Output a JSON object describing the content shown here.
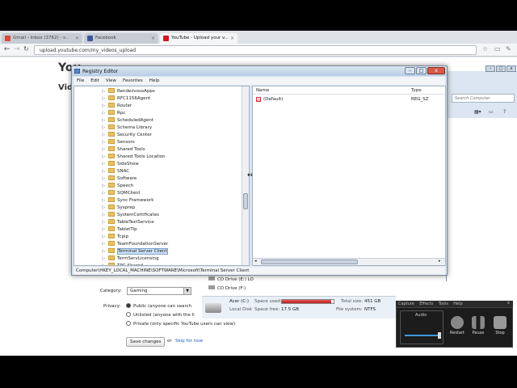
{
  "browser": {
    "tabs": [
      {
        "label": "Gmail - Inbox (3762) - s...",
        "favicon_color": "#d64937"
      },
      {
        "label": "Facebook",
        "favicon_color": "#3b5998"
      },
      {
        "label": "YouTube - Upload your v...",
        "favicon_color": "#cc181e"
      }
    ],
    "address": "upload.youtube.com/my_videos_upload"
  },
  "youtube": {
    "logo": "You",
    "heading": "Vid",
    "category_label": "Category:",
    "category_value": "Gaming",
    "privacy_label": "Privacy:",
    "privacy_options": [
      "Public (anyone can search",
      "Unlisted (anyone with the li",
      "Private (only specific YouTube users can view)"
    ],
    "save_button": "Save changes",
    "or_text": "or",
    "skip_link": "Skip for now"
  },
  "registry": {
    "title": "Registry Editor",
    "menu": [
      "File",
      "Edit",
      "View",
      "Favorites",
      "Help"
    ],
    "tree_items": [
      "RendezvousApps",
      "RFC1156Agent",
      "Router",
      "Rpc",
      "ScheduledAgent",
      "Schema Library",
      "Security Center",
      "Sensors",
      "Shared Tools",
      "Shared Tools Location",
      "SideShow",
      "SNAC",
      "Software",
      "Speech",
      "SQMClient",
      "Sync Framework",
      "Sysprep",
      "SystemCertificates",
      "TableTextService",
      "TabletTip",
      "Tcpip",
      "TeamFoundationServer",
      "Terminal Server Client",
      "TermServLicensing",
      "TPG Shared"
    ],
    "selected_item": "Terminal Server Client",
    "columns": {
      "name": "Name",
      "type": "Type"
    },
    "values": [
      {
        "name": "(Default)",
        "type": "REG_SZ"
      }
    ],
    "status_path": "Computer\\HKEY_LOCAL_MACHINE\\SOFTWARE\\Microsoft\\Terminal Server Client"
  },
  "explorer": {
    "search_placeholder": "Search Computer",
    "drives": [
      "CD Drive (E:) LO",
      "CD Drive (F:)"
    ],
    "details": {
      "drive_name": "Acer (C:)",
      "space_used_label": "Space used:",
      "total_size_label": "Total size:",
      "total_size": "451 GB",
      "drive_type": "Local Disk",
      "space_free_label": "Space free:",
      "space_free": "17.5 GB",
      "file_system_label": "File system:",
      "file_system": "NTFS",
      "used_fraction": 0.96
    }
  },
  "recorder": {
    "menu": [
      "Capture",
      "Effects",
      "Tools",
      "Help"
    ],
    "audio_label": "Audio",
    "buttons": [
      "Restart",
      "Pause",
      "Stop"
    ]
  }
}
